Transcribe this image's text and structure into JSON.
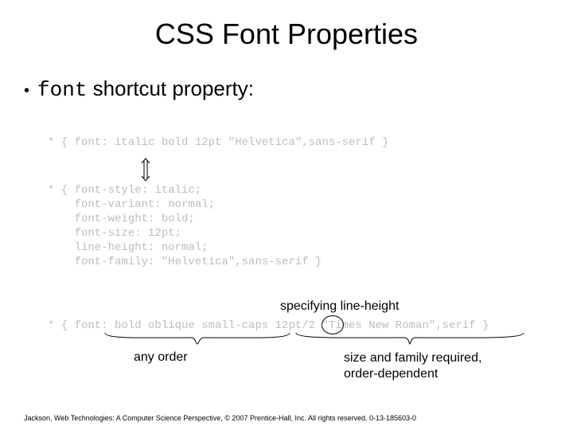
{
  "title": "CSS Font Properties",
  "bullet": {
    "dot": "•",
    "code": "font",
    "rest": " shortcut property:"
  },
  "code_short": "* { font: italic bold 12pt \"Helvetica\",sans-serif }",
  "code_long": [
    "* { font-style: italic;",
    "    font-variant: normal;",
    "    font-weight: bold;",
    "    font-size: 12pt;",
    "    line-height: normal;",
    "    font-family: \"Helvetica\",sans-serif }"
  ],
  "code_full": "* { font: bold oblique small-caps 12pt/2 \"Times New Roman\",serif }",
  "ann": {
    "top": "specifying line-height",
    "left": "any order",
    "right1": "size and family required,",
    "right2": "order-dependent"
  },
  "footer": "Jackson, Web Technologies: A Computer Science Perspective, © 2007 Prentice-Hall, Inc. All rights reserved. 0-13-185603-0"
}
